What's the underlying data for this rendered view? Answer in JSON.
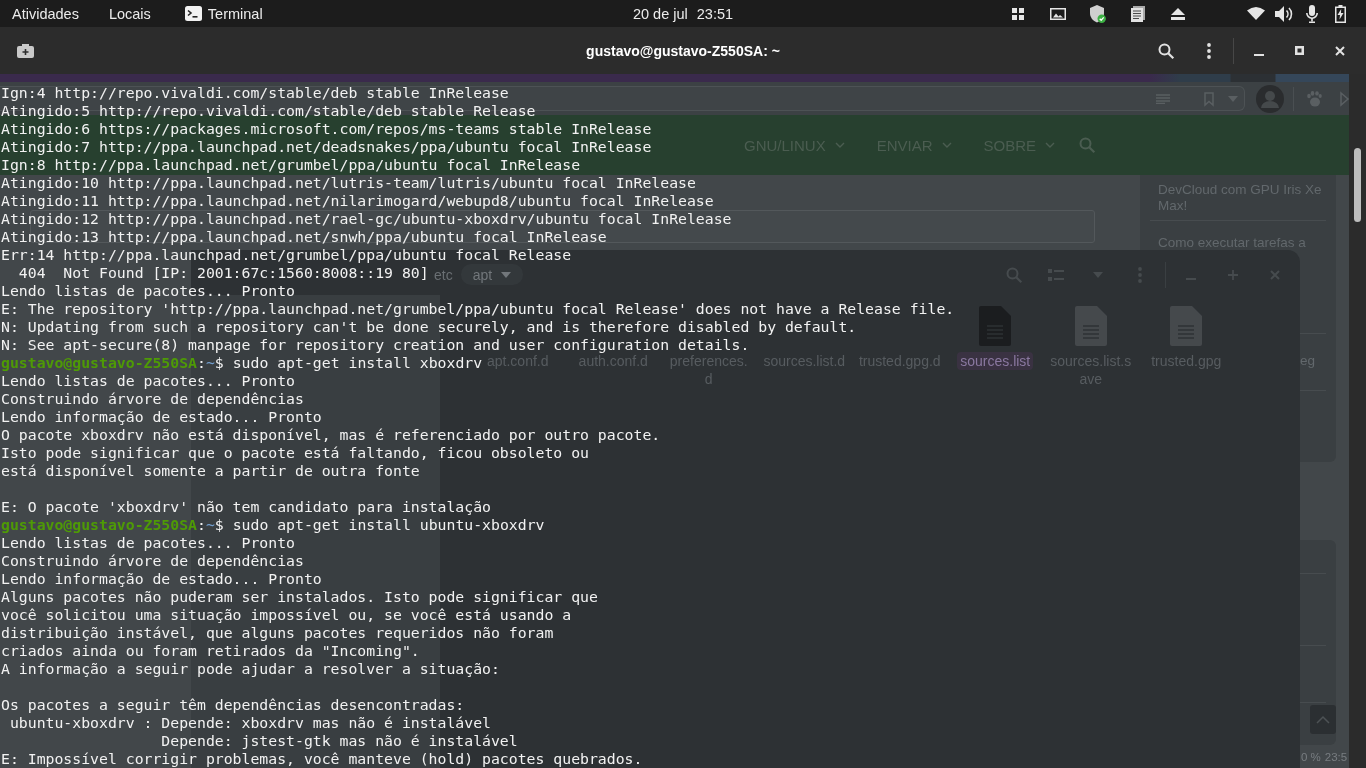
{
  "top_bar": {
    "activities": "Atividades",
    "places": "Locais",
    "app_name": "Terminal",
    "date": "20 de jul",
    "time": "23:51"
  },
  "terminal": {
    "title": "gustavo@gustavo-Z550SA: ~",
    "lines": [
      {
        "kind": "output",
        "text": "Ign:4 http://repo.vivaldi.com/stable/deb stable InRelease"
      },
      {
        "kind": "output",
        "text": "Atingido:5 http://repo.vivaldi.com/stable/deb stable Release"
      },
      {
        "kind": "output",
        "text": "Atingido:6 https://packages.microsoft.com/repos/ms-teams stable InRelease"
      },
      {
        "kind": "output",
        "text": "Atingido:7 http://ppa.launchpad.net/deadsnakes/ppa/ubuntu focal InRelease"
      },
      {
        "kind": "output",
        "text": "Ign:8 http://ppa.launchpad.net/grumbel/ppa/ubuntu focal InRelease"
      },
      {
        "kind": "output",
        "text": "Atingido:10 http://ppa.launchpad.net/lutris-team/lutris/ubuntu focal InRelease"
      },
      {
        "kind": "output",
        "text": "Atingido:11 http://ppa.launchpad.net/nilarimogard/webupd8/ubuntu focal InRelease"
      },
      {
        "kind": "output",
        "text": "Atingido:12 http://ppa.launchpad.net/rael-gc/ubuntu-xboxdrv/ubuntu focal InRelease"
      },
      {
        "kind": "output",
        "text": "Atingido:13 http://ppa.launchpad.net/snwh/ppa/ubuntu focal InRelease"
      },
      {
        "kind": "output",
        "text": "Err:14 http://ppa.launchpad.net/grumbel/ppa/ubuntu focal Release"
      },
      {
        "kind": "output",
        "text": "  404  Not Found [IP: 2001:67c:1560:8008::19 80]"
      },
      {
        "kind": "output",
        "text": "Lendo listas de pacotes... Pronto"
      },
      {
        "kind": "output",
        "text": "E: The repository 'http://ppa.launchpad.net/grumbel/ppa/ubuntu focal Release' does not have a Release file."
      },
      {
        "kind": "output",
        "text": "N: Updating from such a repository can't be done securely, and is therefore disabled by default."
      },
      {
        "kind": "output",
        "text": "N: See apt-secure(8) manpage for repository creation and user configuration details."
      },
      {
        "kind": "prompt",
        "user": "gustavo@gustavo-Z550SA",
        "separator": ":",
        "path": "~",
        "symbol": "$",
        "command": "sudo apt-get install xboxdrv"
      },
      {
        "kind": "output",
        "text": "Lendo listas de pacotes... Pronto"
      },
      {
        "kind": "output",
        "text": "Construindo árvore de dependências"
      },
      {
        "kind": "output",
        "text": "Lendo informação de estado... Pronto"
      },
      {
        "kind": "output",
        "text": "O pacote xboxdrv não está disponível, mas é referenciado por outro pacote."
      },
      {
        "kind": "output",
        "text": "Isto pode significar que o pacote está faltando, ficou obsoleto ou"
      },
      {
        "kind": "output",
        "text": "está disponível somente a partir de outra fonte"
      },
      {
        "kind": "blank"
      },
      {
        "kind": "output",
        "text": "E: O pacote 'xboxdrv' não tem candidato para instalação"
      },
      {
        "kind": "prompt",
        "user": "gustavo@gustavo-Z550SA",
        "separator": ":",
        "path": "~",
        "symbol": "$",
        "command": "sudo apt-get install ubuntu-xboxdrv"
      },
      {
        "kind": "output",
        "text": "Lendo listas de pacotes... Pronto"
      },
      {
        "kind": "output",
        "text": "Construindo árvore de dependências"
      },
      {
        "kind": "output",
        "text": "Lendo informação de estado... Pronto"
      },
      {
        "kind": "output",
        "text": "Alguns pacotes não puderam ser instalados. Isto pode significar que"
      },
      {
        "kind": "output",
        "text": "você solicitou uma situação impossível ou, se você está usando a"
      },
      {
        "kind": "output",
        "text": "distribuição instável, que alguns pacotes requeridos não foram"
      },
      {
        "kind": "output",
        "text": "criados ainda ou foram retirados da \"Incoming\"."
      },
      {
        "kind": "output",
        "text": "A informação a seguir pode ajudar a resolver a situação:"
      },
      {
        "kind": "blank"
      },
      {
        "kind": "output",
        "text": "Os pacotes a seguir têm dependências desencontradas:"
      },
      {
        "kind": "output",
        "text": " ubuntu-xboxdrv : Depende: xboxdrv mas não é instalável"
      },
      {
        "kind": "output",
        "text": "                  Depende: jstest-gtk mas não é instalável"
      },
      {
        "kind": "output",
        "text": "E: Impossível corrigir problemas, você manteve (hold) pacotes quebrados."
      }
    ]
  },
  "browser": {
    "nav_links": [
      "GNU/LINUX",
      "ENVIAR",
      "SOBRE"
    ],
    "sidebar_links": [
      "DevCloud com GPU Iris Xe Max!",
      "Como executar tarefas a",
      "eg"
    ],
    "footer": [
      "0 %",
      "23:5"
    ]
  },
  "file_manager": {
    "path": [
      {
        "label": "etc",
        "selected": false
      },
      {
        "label": "apt",
        "selected": true
      }
    ],
    "files": [
      {
        "name": "apt.conf.d",
        "kind": "folder",
        "selected": false
      },
      {
        "name": "auth.conf.d",
        "kind": "folder",
        "selected": false
      },
      {
        "name": "preferences.d",
        "kind": "folder",
        "selected": false
      },
      {
        "name": "sources.list.d",
        "kind": "folder",
        "selected": false
      },
      {
        "name": "trusted.gpg.d",
        "kind": "folder",
        "selected": false
      },
      {
        "name": "sources.list",
        "kind": "file",
        "selected": true
      },
      {
        "name": "sources.list.save",
        "kind": "file",
        "selected": false
      },
      {
        "name": "trusted.gpg",
        "kind": "file",
        "selected": false
      }
    ]
  }
}
